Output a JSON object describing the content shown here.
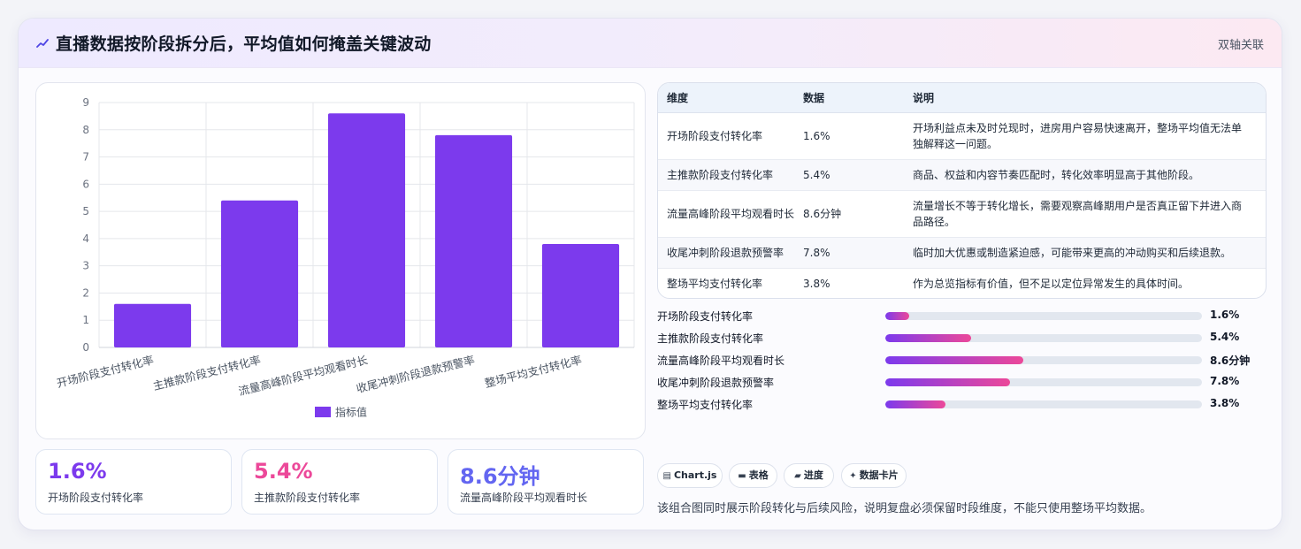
{
  "header": {
    "icon": "trend-line-icon",
    "title": "直播数据按阶段拆分后，平均值如何掩盖关键波动",
    "badge": "双轴关联"
  },
  "chart_data": {
    "type": "bar",
    "categories": [
      "开场阶段支付转化率",
      "主推款阶段支付转化率",
      "流量高峰阶段平均观看时长",
      "收尾冲刺阶段退款预警率",
      "整场平均支付转化率"
    ],
    "series": [
      {
        "name": "指标值",
        "values": [
          1.6,
          5.4,
          8.6,
          7.8,
          3.8
        ],
        "color": "#7c3aed"
      }
    ],
    "ylim": [
      0,
      9
    ],
    "yticks": [
      0,
      1,
      2,
      3,
      4,
      5,
      6,
      7,
      8,
      9
    ],
    "grid": true,
    "legend": "bottom"
  },
  "kpis": [
    {
      "value": "1.6%",
      "label": "开场阶段支付转化率",
      "color": "#7c3aed"
    },
    {
      "value": "5.4%",
      "label": "主推款阶段支付转化率",
      "color": "#ec4899"
    },
    {
      "value": "8.6分钟",
      "label": "流量高峰阶段平均观看时长",
      "color": "#6366f1"
    }
  ],
  "table": {
    "headers": [
      "维度",
      "数据",
      "说明"
    ],
    "rows": [
      {
        "dim": "开场阶段支付转化率",
        "data": "1.6%",
        "note": "开场利益点未及时兑现时，进房用户容易快速离开，整场平均值无法单独解释这一问题。"
      },
      {
        "dim": "主推款阶段支付转化率",
        "data": "5.4%",
        "note": "商品、权益和内容节奏匹配时，转化效率明显高于其他阶段。"
      },
      {
        "dim": "流量高峰阶段平均观看时长",
        "data": "8.6分钟",
        "note": "流量增长不等于转化增长，需要观察高峰期用户是否真正留下并进入商品路径。"
      },
      {
        "dim": "收尾冲刺阶段退款预警率",
        "data": "7.8%",
        "note": "临时加大优惠或制造紧迫感，可能带来更高的冲动购买和后续退款。"
      },
      {
        "dim": "整场平均支付转化率",
        "data": "3.8%",
        "note": "作为总览指标有价值，但不足以定位异常发生的具体时间。"
      }
    ]
  },
  "progress": [
    {
      "label": "开场阶段支付转化率",
      "value": "1.6%",
      "fraction": 0.075
    },
    {
      "label": "主推款阶段支付转化率",
      "value": "5.4%",
      "fraction": 0.27
    },
    {
      "label": "流量高峰阶段平均观看时长",
      "value": "8.6分钟",
      "fraction": 0.435
    },
    {
      "label": "收尾冲刺阶段退款预警率",
      "value": "7.8%",
      "fraction": 0.395
    },
    {
      "label": "整场平均支付转化率",
      "value": "3.8%",
      "fraction": 0.19
    }
  ],
  "tags": [
    {
      "icon": "chart-icon",
      "glyph": "▤",
      "label": "Chart.js"
    },
    {
      "icon": "table-icon",
      "glyph": "▬",
      "label": "表格"
    },
    {
      "icon": "progress-icon",
      "glyph": "▰",
      "label": "进度"
    },
    {
      "icon": "sparkle-icon",
      "glyph": "✦",
      "label": "数据卡片"
    }
  ],
  "footnote": "该组合图同时展示阶段转化与后续风险，说明复盘必须保留时段维度，不能只使用整场平均数据。"
}
